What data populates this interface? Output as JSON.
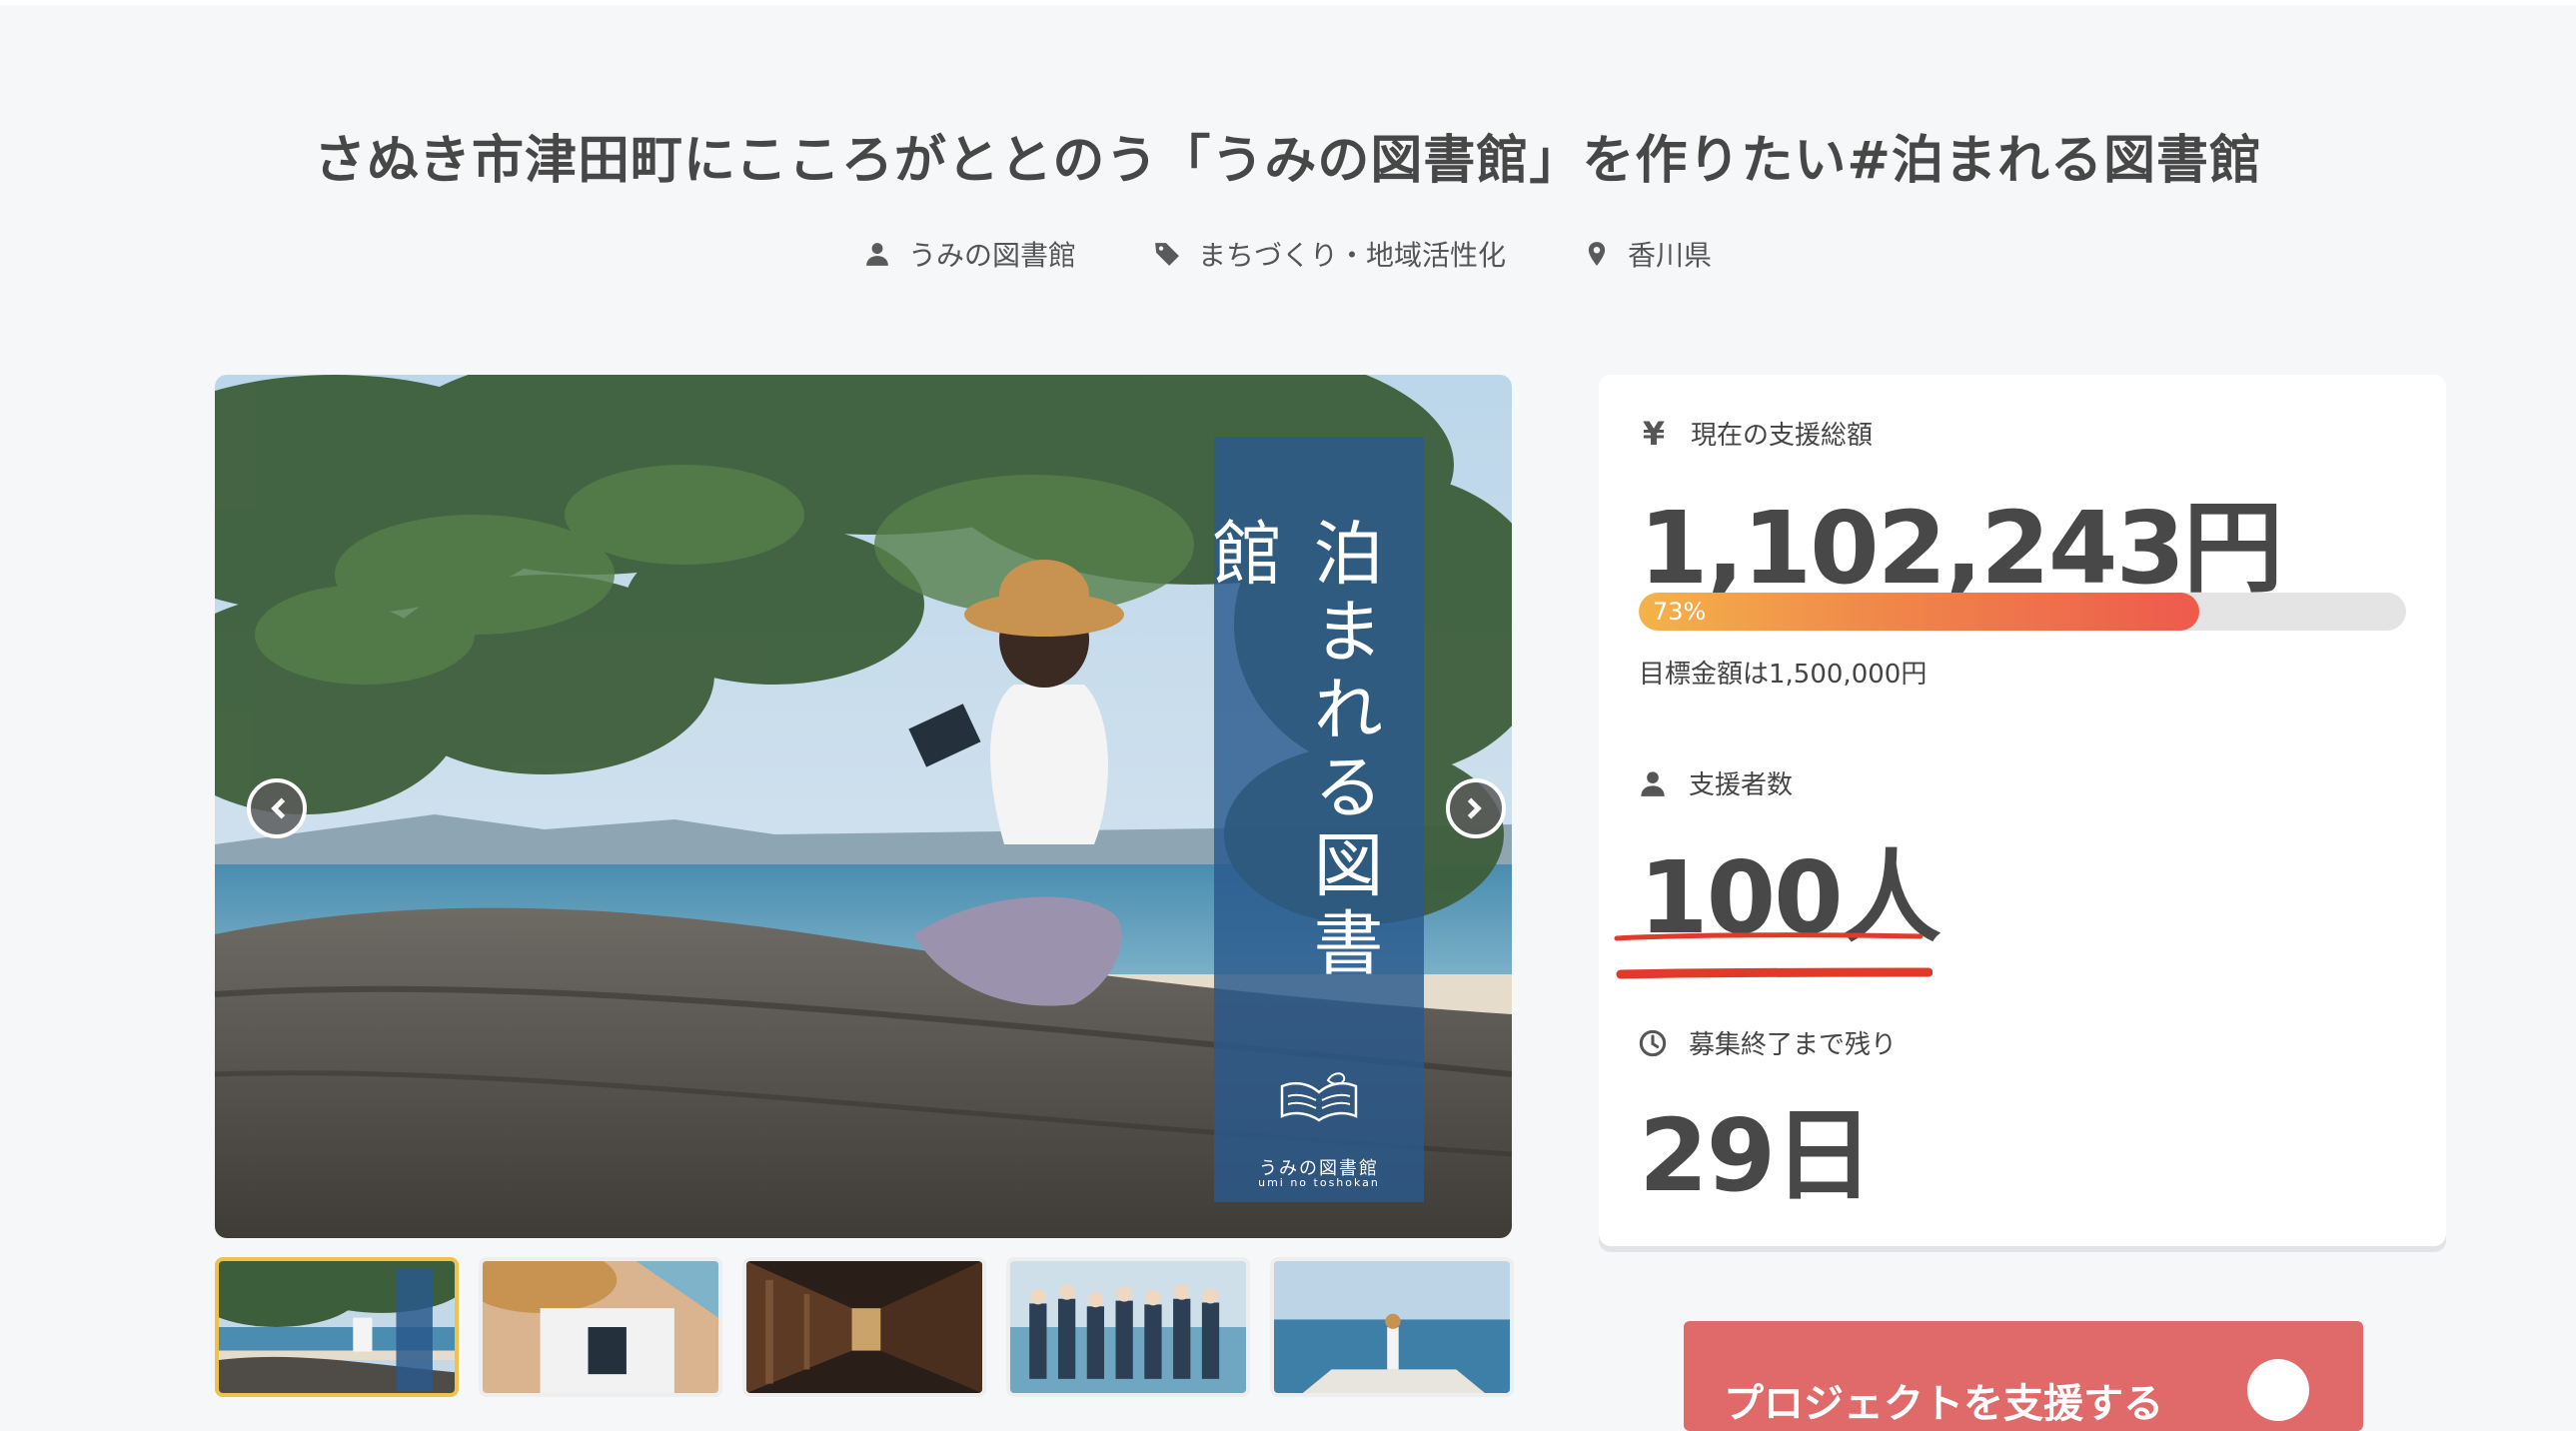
{
  "project": {
    "title": "さぬき市津田町にこころがととのう「うみの図書館」を作りたい#泊まれる図書館",
    "owner": "うみの図書館",
    "category": "まちづくり・地域活性化",
    "location": "香川県"
  },
  "hero": {
    "banner_text": "泊まれる図書館",
    "logo_text": "うみの図書館",
    "logo_subtext": "umi no toshokan"
  },
  "stats": {
    "total_label": "現在の支援総額",
    "total_icon": "¥",
    "total_value": "1,102,243円",
    "progress_percent": 73,
    "progress_label": "73%",
    "goal_text": "目標金額は1,500,000円",
    "supporters_label": "支援者数",
    "supporters_value": "100人",
    "remaining_label": "募集終了まで残り",
    "remaining_value": "29日"
  },
  "cta": {
    "label": "プロジェクトを支援する"
  },
  "colors": {
    "progress_start": "#f4b349",
    "progress_end": "#ee5a4d",
    "banner": "#29598c",
    "underline": "#e03a2a",
    "thumb_active_border": "#f0c24a",
    "cta": "#e06a6a"
  },
  "icons": {
    "owner": "user-icon",
    "category": "tag-icon",
    "location": "map-pin-icon",
    "supporters": "user-icon",
    "remaining": "clock-icon",
    "prev": "chevron-left-icon",
    "next": "chevron-right-icon"
  }
}
